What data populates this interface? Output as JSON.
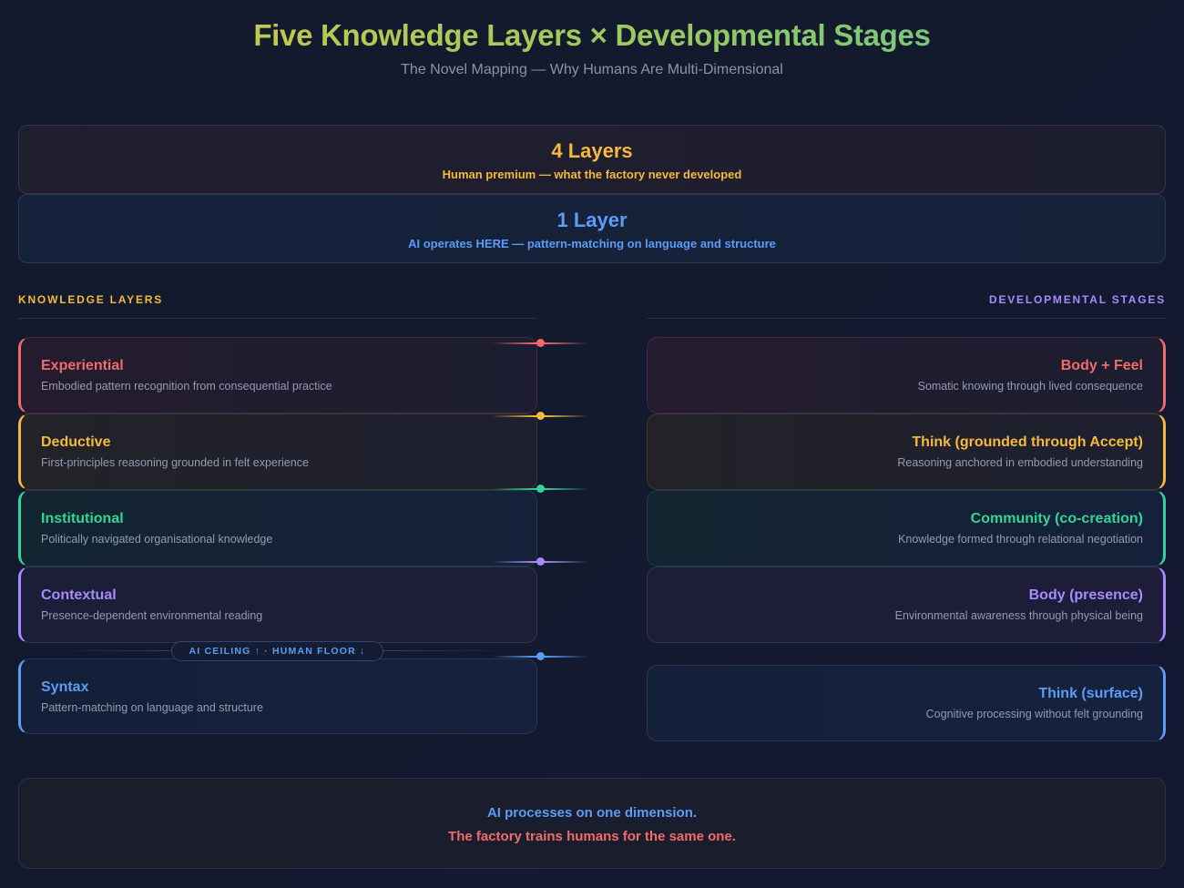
{
  "header": {
    "title": "Five Knowledge Layers × Developmental Stages",
    "subtitle": "The Novel Mapping — Why Humans Are Multi-Dimensional"
  },
  "bands": {
    "human": {
      "count": "4 Layers",
      "caption": "Human premium — what the factory never developed"
    },
    "ai": {
      "count": "1 Layer",
      "caption": "AI operates HERE — pattern-matching on language and structure"
    }
  },
  "columns": {
    "left_heading": "KNOWLEDGE LAYERS",
    "right_heading": "DEVELOPMENTAL STAGES"
  },
  "layers": [
    {
      "name": "Experiential",
      "desc": "Embodied pattern recognition from consequential practice",
      "color": "#f06b6b"
    },
    {
      "name": "Deductive",
      "desc": "First-principles reasoning grounded in felt experience",
      "color": "#f6b93b"
    },
    {
      "name": "Institutional",
      "desc": "Politically navigated organisational knowledge",
      "color": "#34d399"
    },
    {
      "name": "Contextual",
      "desc": "Presence-dependent environmental reading",
      "color": "#a78bfa"
    },
    {
      "name": "Syntax",
      "desc": "Pattern-matching on language and structure",
      "color": "#5b9cf5"
    }
  ],
  "stages": [
    {
      "name": "Body + Feel",
      "desc": "Somatic knowing through lived consequence",
      "color": "#f06b6b"
    },
    {
      "name": "Think (grounded through Accept)",
      "desc": "Reasoning anchored in embodied understanding",
      "color": "#f6b93b"
    },
    {
      "name": "Community (co-creation)",
      "desc": "Knowledge formed through relational negotiation",
      "color": "#34d399"
    },
    {
      "name": "Body (presence)",
      "desc": "Environmental awareness through physical being",
      "color": "#a78bfa"
    },
    {
      "name": "Think (surface)",
      "desc": "Cognitive processing without felt grounding",
      "color": "#5b9cf5"
    }
  ],
  "ceiling_label": "AI CEILING ↑ · HUMAN FLOOR ↓",
  "summary": {
    "line1": "AI processes on one dimension.",
    "line2": "The factory trains humans for the same one."
  }
}
